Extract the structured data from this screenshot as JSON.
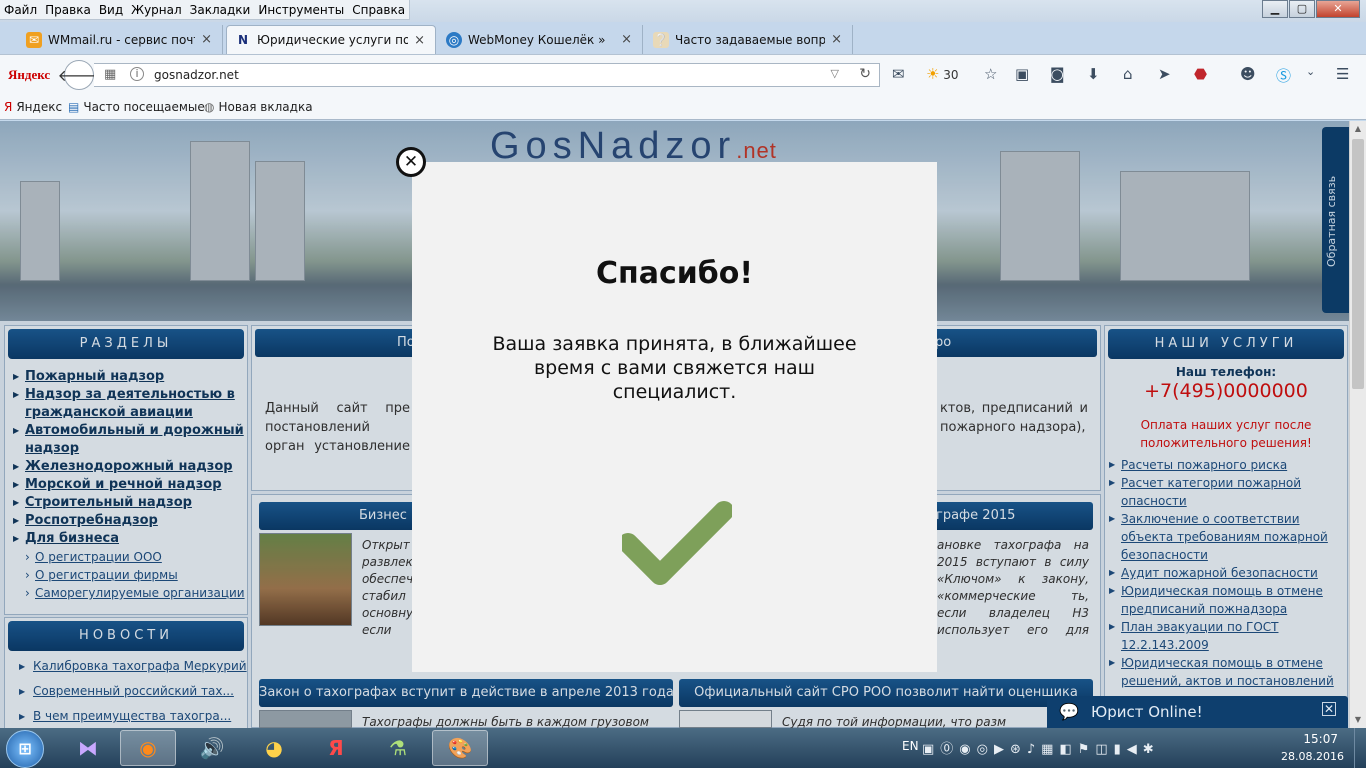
{
  "menubar": {
    "items": [
      "Файл",
      "Правка",
      "Вид",
      "Журнал",
      "Закладки",
      "Инструменты",
      "Справка"
    ]
  },
  "window_buttons": {
    "minimize": "▁",
    "maximize": "▢",
    "close": "✕"
  },
  "tabs": [
    {
      "label": "WMmail.ru - сервис почт...",
      "icon": "wmmail-icon",
      "active": false
    },
    {
      "label": "Юридические услуги по г...",
      "icon": "N",
      "active": true
    },
    {
      "label": "WebMoney Кошелёк »",
      "icon": "webmoney-icon",
      "active": false
    },
    {
      "label": "Часто задаваемые вопрос...",
      "icon": "faq-icon",
      "active": false
    }
  ],
  "tab_close": "×",
  "new_tab": "+",
  "navbar": {
    "yandex_logo": "Яндекс",
    "url": "gosnadzor.net",
    "weather": "30"
  },
  "bookmarks": [
    {
      "label": "Яндекс",
      "icon": "yandex-icon"
    },
    {
      "label": "Часто посещаемые",
      "icon": "frequent-icon"
    },
    {
      "label": "Новая вкладка",
      "icon": "globe-icon"
    }
  ],
  "site": {
    "logo_main": "GosNadzor",
    "logo_tld": ".net",
    "feedback": "Обратная связь",
    "left_sections_title": "РАЗДЕЛЫ",
    "sections": [
      "Пожарный надзор",
      "Надзор за деятельностью в гражданской авиации",
      "Автомобильный и дорожный надзор",
      "Железнодорожный надзор",
      "Морской и речной надзор",
      "Строительный надзор",
      "Роспотребнадзор",
      "Для бизнеса"
    ],
    "business_sub": [
      "О регистрации ООО",
      "О регистрации фирмы",
      "Саморегулируемые организации"
    ],
    "news_title": "НОВОСТИ",
    "news": [
      "Калибровка тахографа Меркурий",
      "Современный российский тах...",
      "В чем преимущества тахогра..."
    ],
    "center_head_left": "По",
    "center_head_right": "ро",
    "center_text_left": "Данный сайт пре постановлений орган установление истинно",
    "center_text_right": "ктов, предписаний и пожарного надзора),",
    "block1_head_left": "Бизнес п",
    "block1_head_right": "графе 2015",
    "block1_text_left": "Открыт развлек обеспеч стабил основну если местор",
    "block1_text_right": "ановке тахографа на 2015 вступают в силу «Ключом» к закону, «коммерческие ть, если владелец Н3 использует его для обой, то установка",
    "block2_head": "Закон о тахографах вступит в действие в апреле 2013 года",
    "block2_text": "Тахографы должны быть в каждом грузовом",
    "block3_head": "Официальный сайт СРО РОО позволит найти оценщика",
    "block3_text": "Судя по той информации, что разм",
    "services_title": "НАШИ УСЛУГИ",
    "phone_label": "Наш телефон:",
    "phone": "+7(495)0000000",
    "payment_note": "Оплата наших услуг после положительного решения!",
    "services": [
      "Расчеты пожарного риска",
      "Расчет категории пожарной опасности",
      "Заключение о соответствии объекта требованиям пожарной безопасности",
      "Аудит пожарной безопасности",
      "Юридическая помощь в отмене предписаний пожнадзора",
      "План эвакуации по ГОСТ 12.2.143.2009",
      "Юридическая помощь в отмене решений, актов и постановлений"
    ]
  },
  "modal": {
    "title": "Спасибо!",
    "message": "Ваша заявка принята, в ближайшее время с вами свяжется наш специалист.",
    "close": "✕"
  },
  "chat": {
    "label": "Юрист Online!",
    "close": "✕"
  },
  "taskbar": {
    "lang": "EN",
    "time": "15:07",
    "date": "28.08.2016"
  },
  "colors": {
    "accent": "#0e3f6e",
    "check": "#7ea05a",
    "phone": "#d01010"
  }
}
